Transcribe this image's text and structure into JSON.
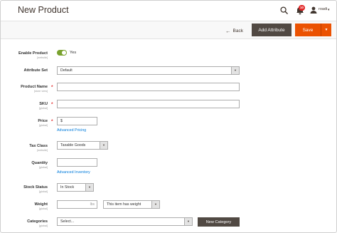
{
  "header": {
    "title": "New Product",
    "notifications_count": "10",
    "user_name": "roadi",
    "user_chevron": "▾"
  },
  "actions": {
    "back_label": "Back",
    "back_arrow": "←",
    "add_attribute_label": "Add Attribute",
    "save_label": "Save",
    "save_split_arrow": "▼"
  },
  "form": {
    "enable_product": {
      "label": "Enable Product",
      "scope": "[website]",
      "value_text": "Yes",
      "enabled": true
    },
    "attribute_set": {
      "label": "Attribute Set",
      "value": "Default"
    },
    "product_name": {
      "label": "Product Name",
      "scope": "[store view]",
      "required": "*",
      "value": ""
    },
    "sku": {
      "label": "SKU",
      "scope": "[global]",
      "required": "*",
      "value": ""
    },
    "price": {
      "label": "Price",
      "scope": "[global]",
      "required": "*",
      "currency": "$",
      "link": "Advanced Pricing"
    },
    "tax_class": {
      "label": "Tax Class",
      "scope": "[website]",
      "value": "Taxable Goods"
    },
    "quantity": {
      "label": "Quantity",
      "scope": "[global]",
      "value": "",
      "link": "Advanced Inventory"
    },
    "stock_status": {
      "label": "Stock Status",
      "scope": "[global]",
      "value": "In Stock"
    },
    "weight": {
      "label": "Weight",
      "scope": "[global]",
      "unit": "lbs",
      "has_weight": "This item has weight"
    },
    "categories": {
      "label": "Categories",
      "scope": "[global]",
      "placeholder": "Select...",
      "new_button": "New Category"
    }
  },
  "colors": {
    "accent": "#eb5202",
    "dark_button": "#514943",
    "toggle_on": "#79a22e",
    "link": "#007bdb",
    "required": "#e22626"
  },
  "icons": {
    "search": "search-icon",
    "bell": "bell-icon",
    "user": "user-icon",
    "select_arrow": "▼"
  }
}
